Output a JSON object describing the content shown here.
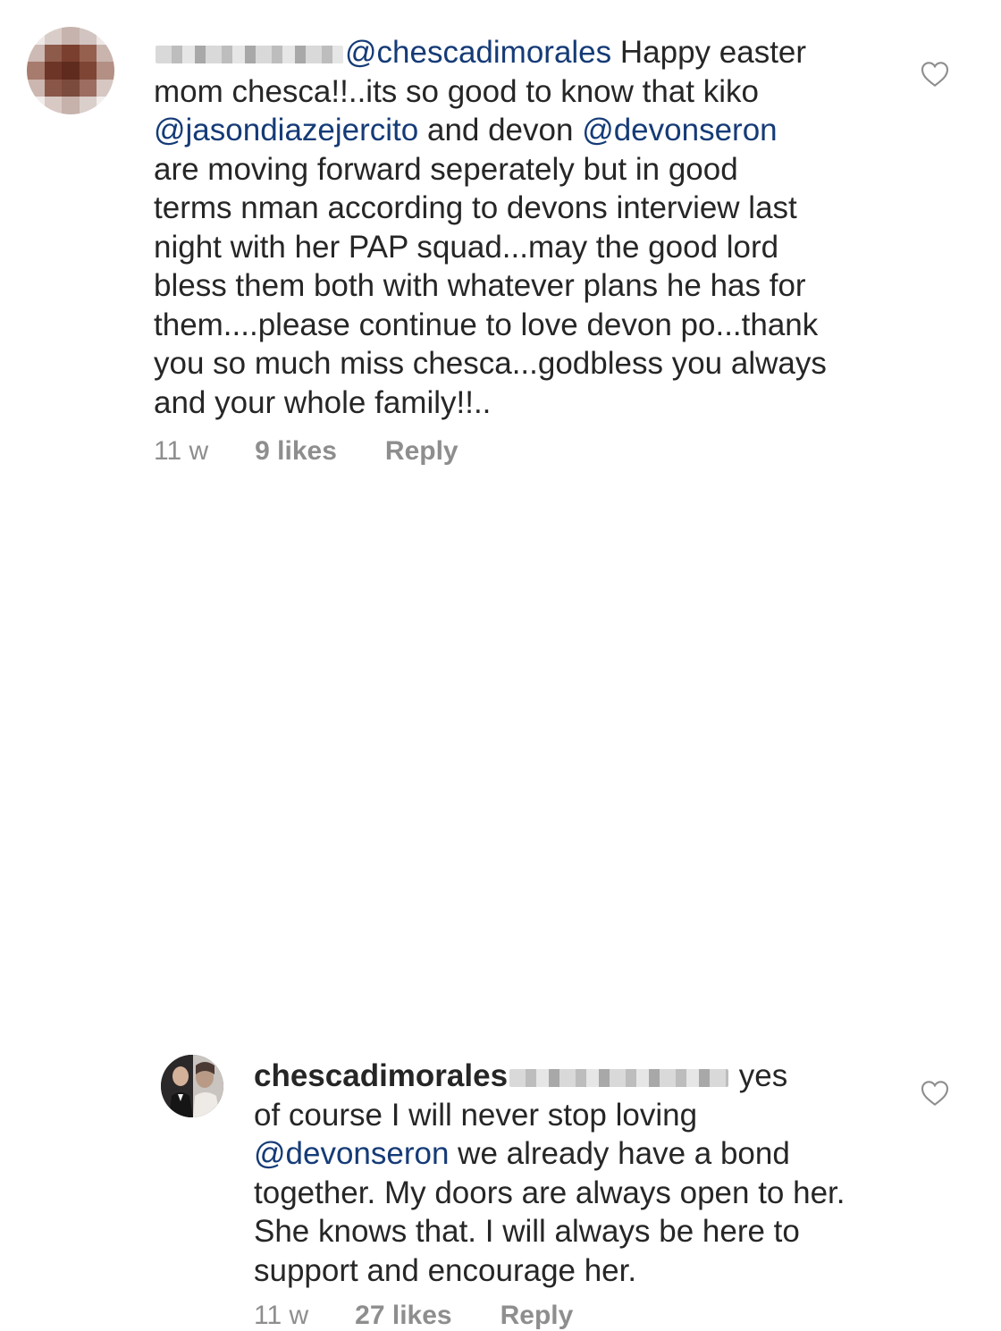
{
  "comments": [
    {
      "blurred_username": true,
      "mention": "@chescadimorales",
      "body_lines": [
        " Happy easter",
        "mom chesca!!..its so good to know that kiko",
        "@jasondiazejercito|| and devon ||@devonseron",
        "are moving forward seperately but in good",
        "terms nman according to devons interview last",
        "night with her PAP squad...may the good lord",
        "bless them both with whatever plans he has for",
        "them....please continue to love devon po...thank",
        "you so much miss chesca...godbless you always",
        "and your whole family!!.."
      ],
      "age": "11 w",
      "likes": "9 likes",
      "reply": "Reply",
      "avatar_icon": "pixelated-avatar-icon",
      "like_icon": "heart-outline-icon"
    },
    {
      "username": "chescadimorales",
      "blurred_mention": true,
      "body_lines": [
        " yes",
        "of course I will never stop loving",
        "@devonseron|| we already have a bond",
        "together. My doors are always open to her.",
        "She knows that. I will always be here to",
        "support and encourage her."
      ],
      "age": "11 w",
      "likes": "27 likes",
      "reply": "Reply",
      "avatar_icon": "profile-photo-avatar-icon",
      "like_icon": "heart-outline-icon"
    }
  ],
  "colors": {
    "text": "#262626",
    "mention": "#153b77",
    "meta": "#8e8e8e",
    "background": "#ffffff"
  }
}
